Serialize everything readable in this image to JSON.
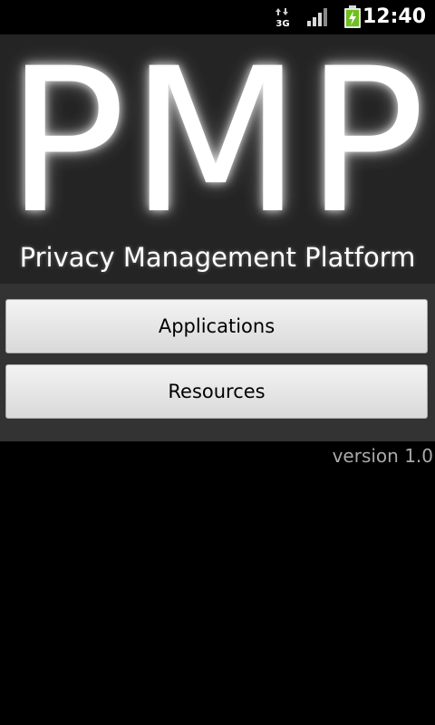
{
  "status_bar": {
    "network_label": "3G",
    "time": "12:40",
    "icons": [
      "data-arrows-icon",
      "signal-icon",
      "battery-charging-icon"
    ]
  },
  "header": {
    "logo": "PMP",
    "subtitle": "Privacy Management Platform",
    "background": "#242424"
  },
  "buttons": {
    "applications": "Applications",
    "resources": "Resources"
  },
  "footer": {
    "version": "version 1.0"
  }
}
